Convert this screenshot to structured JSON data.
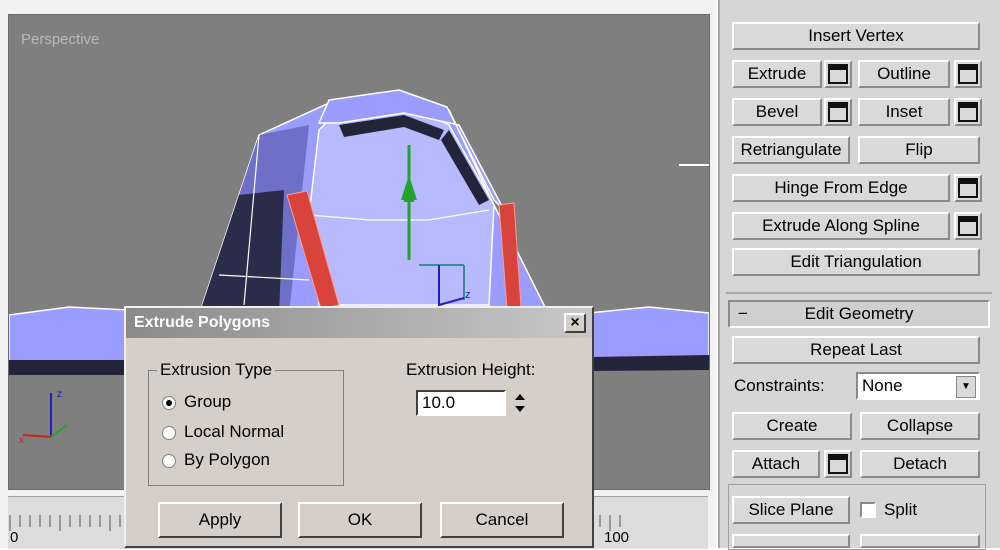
{
  "viewport": {
    "label": "Perspective",
    "ruler_labels": [
      "0",
      "100"
    ]
  },
  "panel": {
    "insert_vertex": "Insert Vertex",
    "extrude": "Extrude",
    "outline": "Outline",
    "bevel": "Bevel",
    "inset": "Inset",
    "retriangulate": "Retriangulate",
    "flip": "Flip",
    "hinge_from_edge": "Hinge From Edge",
    "extrude_along_spline": "Extrude Along Spline",
    "edit_triangulation": "Edit Triangulation",
    "rollout_minus": "−",
    "rollout_title": "Edit Geometry",
    "repeat_last": "Repeat Last",
    "constraints_label": "Constraints:",
    "constraints_value": "None",
    "create": "Create",
    "collapse": "Collapse",
    "attach": "Attach",
    "detach": "Detach",
    "slice_plane": "Slice Plane",
    "split": "Split"
  },
  "dialog": {
    "title": "Extrude Polygons",
    "close": "×",
    "group_label": "Extrusion Type",
    "options": [
      {
        "label": "Group",
        "selected": true
      },
      {
        "label": "Local Normal",
        "selected": false
      },
      {
        "label": "By Polygon",
        "selected": false
      }
    ],
    "height_label": "Extrusion Height:",
    "height_value": "10.0",
    "apply": "Apply",
    "ok": "OK",
    "cancel": "Cancel"
  },
  "icons": {
    "settings_box": "settings-square-icon",
    "spinner": "spinner-arrows-icon",
    "dropdown": "chevron-down-icon",
    "axis_gizmo": "axis-tripod-icon",
    "transform_gizmo": "move-gizmo-icon"
  },
  "colors": {
    "mesh": "#9a9cff",
    "mesh_dark": "#23233a",
    "selected_faces": "#d8443c",
    "gizmo_green": "#22a52a",
    "viewport_bg": "#7f7f7f"
  }
}
